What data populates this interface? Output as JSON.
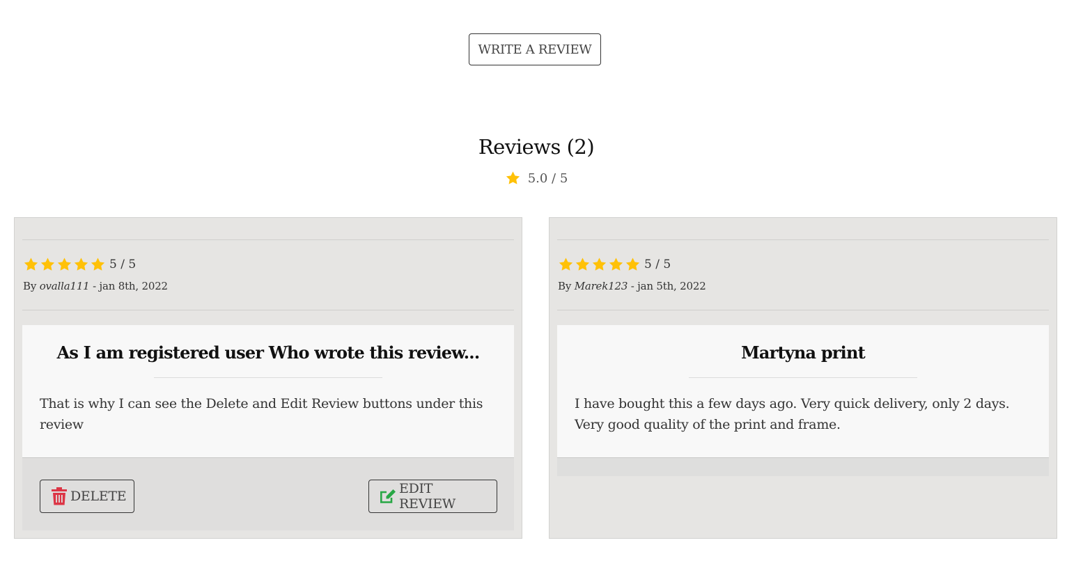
{
  "write_button": "WRITE A REVIEW",
  "summary": {
    "title": "Reviews (2)",
    "average": "5.0 / 5"
  },
  "colors": {
    "star": "#ffc107",
    "delete": "#dc3545",
    "edit": "#28a745"
  },
  "reviews": [
    {
      "stars": 5,
      "score": "5 / 5",
      "by": "By",
      "author": "ovalla111",
      "date": "- jan 8th, 2022",
      "title": "As I am registered user Who wrote this review...",
      "body": "That is why I can see the Delete and Edit Review buttons under this review",
      "delete_label": "DELETE",
      "edit_label": "EDIT REVIEW"
    },
    {
      "stars": 5,
      "score": "5 / 5",
      "by": "By",
      "author": "Marek123",
      "date": "- jan 5th, 2022",
      "title": "Martyna print",
      "body": "I have bought this a few days ago. Very quick delivery, only 2 days. Very good quality of the print and frame."
    }
  ]
}
